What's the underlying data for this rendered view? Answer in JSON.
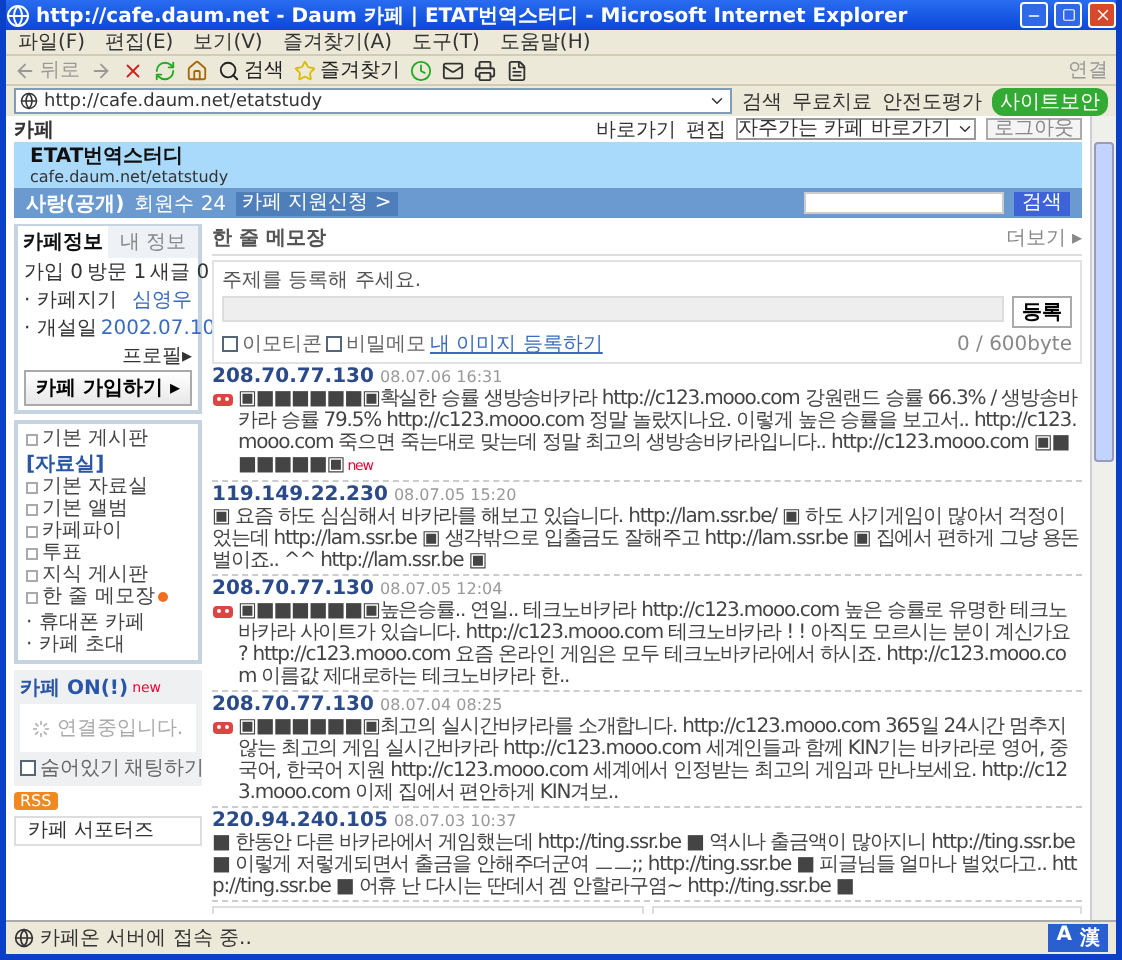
{
  "window": {
    "title": "http://cafe.daum.net - Daum 카페 | ETAT번역스터디 - Microsoft Internet Explorer"
  },
  "menu": [
    "파일(F)",
    "편집(E)",
    "보기(V)",
    "즐겨찾기(A)",
    "도구(T)",
    "도움말(H)"
  ],
  "toolbar": {
    "back": "뒤로",
    "search": "검색",
    "favorites": "즐겨찾기",
    "links": "연결"
  },
  "address_bar": {
    "value": "http://cafe.daum.net/etatstudy",
    "links": [
      "검색",
      "무료치료",
      "안전도평가",
      "사이트보안"
    ]
  },
  "cafe_top": {
    "logo": "카페",
    "shortcut": "바로가기",
    "edit": "편집",
    "dropdown": "자주가는 카페 바로가기",
    "logout": "로그아웃"
  },
  "banner": {
    "title": "ETAT번역스터디",
    "url": "cafe.daum.net/etatstudy"
  },
  "nav": {
    "status": "사랑(공개)",
    "members": "회원수 24",
    "apply": "카페 지원신청 >",
    "search_button": "검색"
  },
  "sidebar": {
    "tabs": [
      {
        "label": "카페정보",
        "selected": true
      },
      {
        "label": "내 정보",
        "selected": false
      }
    ],
    "stats": [
      "가입 0",
      "방문 1",
      "새글 0"
    ],
    "info": [
      {
        "label": "· 카페지기",
        "value": "심영우"
      },
      {
        "label": "· 개설일",
        "value": "2002.07.10"
      }
    ],
    "profile": "프로필▸",
    "join": "카페 가입하기 ▸",
    "menu": [
      {
        "label": "기본 게시판",
        "kind": "board",
        "new": false
      },
      {
        "label": "[자료실]",
        "kind": "group",
        "new": false
      },
      {
        "label": "기본 자료실",
        "kind": "board",
        "new": false
      },
      {
        "label": "기본 앨범",
        "kind": "board",
        "new": false
      },
      {
        "label": "카페파이",
        "kind": "board",
        "new": false
      },
      {
        "label": "투표",
        "kind": "board",
        "new": false
      },
      {
        "label": "지식 게시판",
        "kind": "board",
        "new": false
      },
      {
        "label": "한 줄 메모장",
        "kind": "board",
        "new": true
      },
      {
        "label": "· 휴대폰 카페",
        "kind": "link",
        "new": false
      },
      {
        "label": "· 카페 초대",
        "kind": "link",
        "new": false
      }
    ]
  },
  "cafe_on": {
    "title": "카페 ON(!)",
    "badge": "new",
    "loading": "연결중입니다.",
    "hide": {
      "label": "숨어있기",
      "checked": false
    },
    "chat": "채팅하기"
  },
  "rss": "RSS",
  "supporters": "카페 서포터즈",
  "memo": {
    "title": "한 줄 메모장",
    "more": "더보기 ▸",
    "prompt": "주제를 등록해 주세요.",
    "submit": "등록",
    "options": [
      {
        "label": "이모티콘",
        "checked": false
      },
      {
        "label": "비밀메모",
        "checked": false
      }
    ],
    "image_link": "내 이미지 등록하기",
    "counter": "0 / 600byte",
    "posts": [
      {
        "ip": "208.70.77.130",
        "date": "08.07.06 16:31",
        "emoticon": true,
        "badge": "new",
        "text": "▣■■■■■■▣확실한 승률 생방송바카라 http://c123.mooo.com 강원랜드 승률 66.3% / 생방송바카라 승률 79.5% http://c123.mooo.com 정말 놀랐지나요. 이렇게 높은 승률을 보고서.. http://c123.mooo.com 죽으면 죽는대로 맞는데 정말 최고의 생방송바카라입니다.. http://c123.mooo.com ▣■■■■■■▣"
      },
      {
        "ip": "119.149.22.230",
        "date": "08.07.05 15:20",
        "emoticon": false,
        "text": "▣ 요즘 하도 심심해서 바카라를 해보고 있습니다. http://lam.ssr.be/ ▣ 하도 사기게임이 많아서 걱정이었는데 http://lam.ssr.be ▣ 생각밖으로 입출금도 잘해주고 http://lam.ssr.be ▣ 집에서 편하게 그냥 용돈벌이죠.. ^^ http://lam.ssr.be ▣"
      },
      {
        "ip": "208.70.77.130",
        "date": "08.07.05 12:04",
        "emoticon": true,
        "text": "▣■■■■■■▣높은승률.. 연일.. 테크노바카라 http://c123.mooo.com 높은 승률로 유명한 테크노바카라 사이트가 있습니다. http://c123.mooo.com 테크노바카라 ! ! 아직도 모르시는 분이 계신가요 ? http://c123.mooo.com 요즘 온라인 게임은 모두 테크노바카라에서 하시죠. http://c123.mooo.com 이름값 제대로하는 테크노바카라 한.."
      },
      {
        "ip": "208.70.77.130",
        "date": "08.07.04 08:25",
        "emoticon": true,
        "text": "▣■■■■■■▣최고의 실시간바카라를 소개합니다. http://c123.mooo.com 365일 24시간 멈추지 않는 최고의 게임 실시간바카라 http://c123.mooo.com 세계인들과 함께 KIN기는 바카라로 영어, 중국어, 한국어 지원 http://c123.mooo.com 세계에서 인정받는 최고의 게임과 만나보세요. http://c123.mooo.com 이제 집에서 편안하게 KIN겨보.."
      },
      {
        "ip": "220.94.240.105",
        "date": "08.07.03 10:37",
        "emoticon": false,
        "text": "■ 한동안 다른 바카라에서 게임했는데 http://ting.ssr.be ■ 역시나 출금액이 많아지니 http://ting.ssr.be ■ 이렇게 저렇게되면서 출금을 안해주더군여 ㅡㅡ;; http://ting.ssr.be ■ 피글님들 얼마나 벌었다고.. http://ting.ssr.be ■ 어휴 난 다시는 딴데서 겜 안할라구염~ http://ting.ssr.be ■"
      }
    ]
  },
  "status_bar": {
    "text": "카페온 서버에 접속 중..",
    "ime": [
      "A",
      "漢"
    ]
  }
}
